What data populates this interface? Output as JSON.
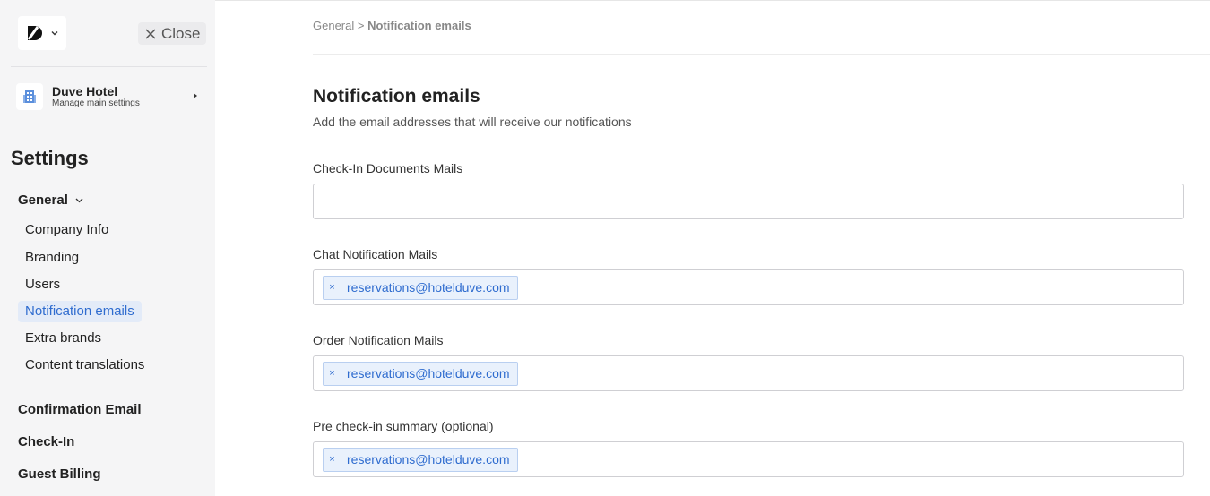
{
  "sidebar": {
    "close_label": "Close",
    "hotel": {
      "name": "Duve Hotel",
      "subtitle": "Manage main settings"
    },
    "settings_title": "Settings",
    "general_label": "General",
    "general_items": [
      {
        "label": "Company Info",
        "active": false
      },
      {
        "label": "Branding",
        "active": false
      },
      {
        "label": "Users",
        "active": false
      },
      {
        "label": "Notification emails",
        "active": true
      },
      {
        "label": "Extra brands",
        "active": false
      },
      {
        "label": "Content translations",
        "active": false
      }
    ],
    "groups": [
      {
        "label": "Confirmation Email"
      },
      {
        "label": "Check-In"
      },
      {
        "label": "Guest Billing"
      }
    ]
  },
  "breadcrumb": {
    "parent": "General",
    "separator": ">",
    "current": "Notification emails"
  },
  "main": {
    "title": "Notification emails",
    "subtitle": "Add the email addresses that will receive our notifications",
    "fields": [
      {
        "label": "Check-In Documents Mails",
        "tags": []
      },
      {
        "label": "Chat Notification Mails",
        "tags": [
          "reservations@hotelduve.com"
        ]
      },
      {
        "label": "Order Notification Mails",
        "tags": [
          "reservations@hotelduve.com"
        ]
      },
      {
        "label": "Pre check-in summary (optional)",
        "tags": [
          "reservations@hotelduve.com"
        ]
      }
    ],
    "tag_remove_glyph": "×"
  },
  "colors": {
    "accent": "#2f6ccf",
    "active_bg": "#e3ebf8",
    "sidebar_bg": "#f5f5f6"
  }
}
